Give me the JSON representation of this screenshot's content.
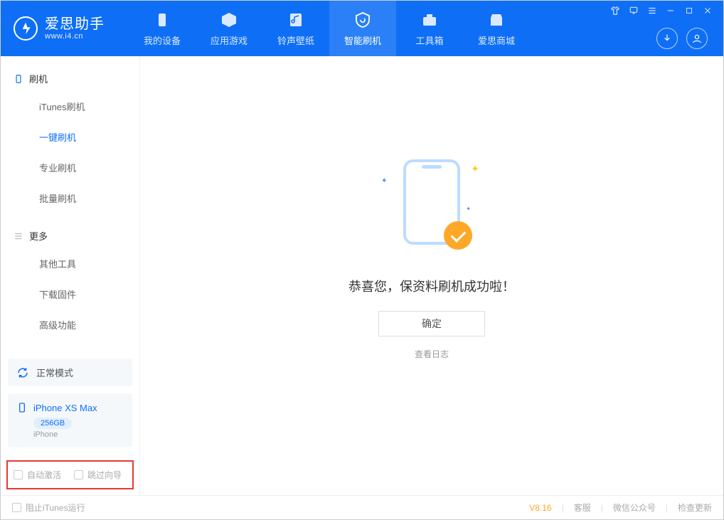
{
  "logo": {
    "title": "爱思助手",
    "subtitle": "www.i4.cn"
  },
  "topTabs": [
    {
      "label": "我的设备"
    },
    {
      "label": "应用游戏"
    },
    {
      "label": "铃声壁纸"
    },
    {
      "label": "智能刷机"
    },
    {
      "label": "工具箱"
    },
    {
      "label": "爱思商城"
    }
  ],
  "sidebar": {
    "flash": {
      "header": "刷机",
      "items": [
        "iTunes刷机",
        "一键刷机",
        "专业刷机",
        "批量刷机"
      ]
    },
    "more": {
      "header": "更多",
      "items": [
        "其他工具",
        "下载固件",
        "高级功能"
      ]
    }
  },
  "mode": {
    "label": "正常模式"
  },
  "device": {
    "name": "iPhone XS Max",
    "capacity": "256GB",
    "type": "iPhone"
  },
  "options": {
    "autoActivate": "自动激活",
    "skipGuide": "跳过向导"
  },
  "result": {
    "message": "恭喜您，保资料刷机成功啦！",
    "okBtn": "确定",
    "logLink": "查看日志"
  },
  "footer": {
    "blockItunes": "阻止iTunes运行",
    "version": "V8.16",
    "service": "客服",
    "wechat": "微信公众号",
    "update": "检查更新"
  }
}
